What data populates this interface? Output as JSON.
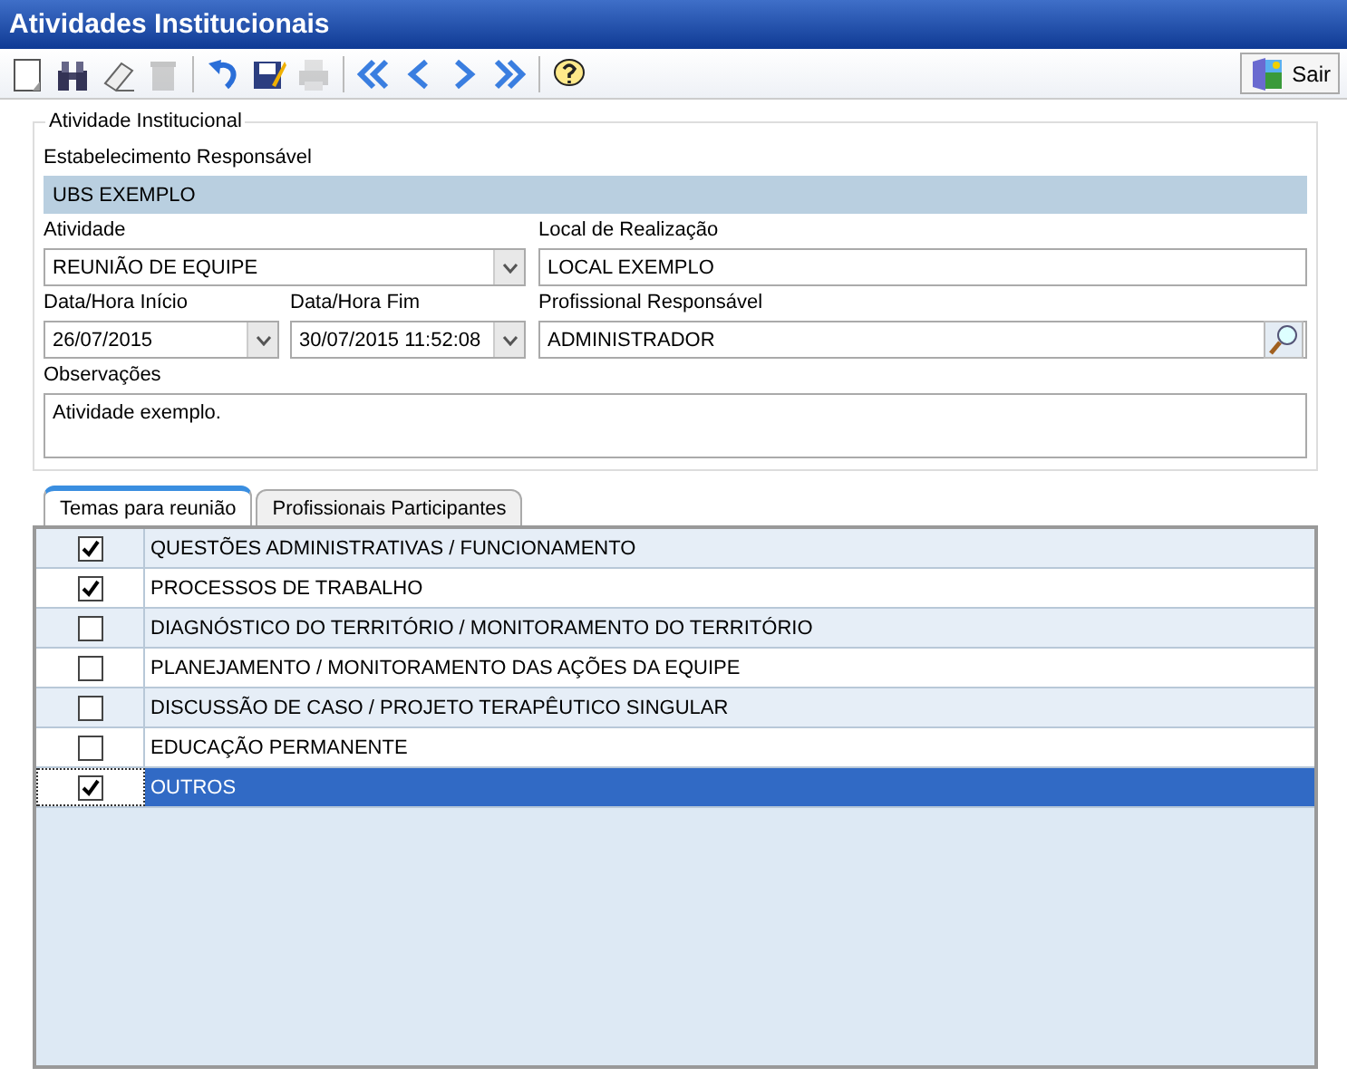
{
  "window": {
    "title": "Atividades Institucionais"
  },
  "toolbar": [
    {
      "kind": "new",
      "disabled": false
    },
    {
      "kind": "search",
      "disabled": false
    },
    {
      "kind": "erase",
      "disabled": false
    },
    {
      "kind": "delete",
      "disabled": true
    },
    {
      "kind": "undo",
      "disabled": false
    },
    {
      "kind": "save",
      "disabled": false
    },
    {
      "kind": "print",
      "disabled": true
    },
    {
      "kind": "first",
      "disabled": false
    },
    {
      "kind": "prev",
      "disabled": false
    },
    {
      "kind": "next",
      "disabled": false
    },
    {
      "kind": "last",
      "disabled": false
    },
    {
      "kind": "help",
      "disabled": false
    }
  ],
  "exit_button": {
    "label": "Sair"
  },
  "form": {
    "legend": "Atividade Institucional",
    "establishment": {
      "label": "Estabelecimento Responsável",
      "value": "UBS EXEMPLO"
    },
    "activity": {
      "label": "Atividade",
      "value": "REUNIÃO DE EQUIPE"
    },
    "location": {
      "label": "Local de Realização",
      "value": "LOCAL EXEMPLO"
    },
    "start": {
      "label": "Data/Hora Início",
      "value": "26/07/2015"
    },
    "end": {
      "label": "Data/Hora Fim",
      "value": "30/07/2015 11:52:08"
    },
    "professional": {
      "label": "Profissional Responsável",
      "value": "ADMINISTRADOR"
    },
    "notes": {
      "label": "Observações",
      "value": "Atividade exemplo."
    }
  },
  "tabs": [
    {
      "label": "Temas para reunião",
      "selected": true
    },
    {
      "label": "Profissionais Participantes",
      "selected": false
    }
  ],
  "topics": [
    {
      "label": "QUESTÕES ADMINISTRATIVAS / FUNCIONAMENTO",
      "checked": true,
      "selected": false
    },
    {
      "label": "PROCESSOS DE TRABALHO",
      "checked": true,
      "selected": false
    },
    {
      "label": "DIAGNÓSTICO DO TERRITÓRIO / MONITORAMENTO DO TERRITÓRIO",
      "checked": false,
      "selected": false
    },
    {
      "label": "PLANEJAMENTO / MONITORAMENTO DAS AÇÕES DA EQUIPE",
      "checked": false,
      "selected": false
    },
    {
      "label": "DISCUSSÃO DE CASO / PROJETO TERAPÊUTICO SINGULAR",
      "checked": false,
      "selected": false
    },
    {
      "label": "EDUCAÇÃO PERMANENTE",
      "checked": false,
      "selected": false
    },
    {
      "label": "OUTROS",
      "checked": true,
      "selected": true
    }
  ]
}
